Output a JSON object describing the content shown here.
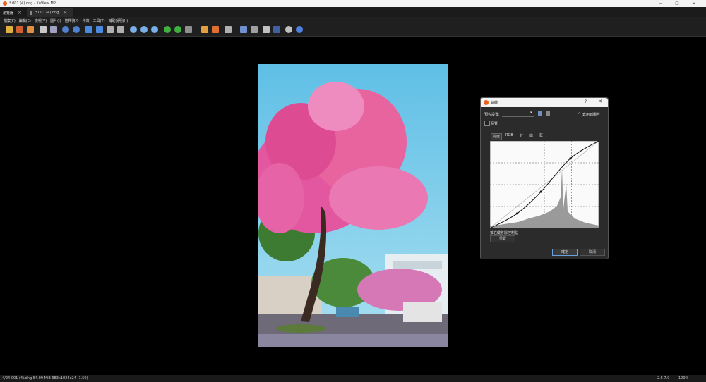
{
  "window": {
    "title": "* 001 (4).dng - XnView MP",
    "minimize": "─",
    "maximize": "☐",
    "close": "✕"
  },
  "tabs": [
    {
      "label": "瀏覽器"
    },
    {
      "label": "* 001 (4).dng"
    }
  ],
  "menu": [
    "檔案(F)",
    "編輯(E)",
    "檢視(V)",
    "圖片(I)",
    "詮釋資料",
    "特效",
    "工具(T)",
    "輔助說明(H)"
  ],
  "status": {
    "left": "4/24   001 (4).dng   54.09 MiB   683x1024x24 (1.50)",
    "right": [
      "2.5 7.9",
      "100%"
    ]
  },
  "dialog": {
    "title": "曲線",
    "help": "?",
    "close": "✕",
    "preset_label": "預先設置:",
    "apply_label": "套用到圖片",
    "apply_checked": "✓",
    "preview_label": "預覽",
    "channels": [
      "亮度",
      "RGB",
      "紅",
      "綠",
      "藍"
    ],
    "hint": "按右鍵移除控制點",
    "reset": "重置",
    "ok": "確定",
    "cancel": "取消",
    "curve_points": [
      [
        0,
        0
      ],
      [
        0.25,
        0.17
      ],
      [
        0.47,
        0.42
      ],
      [
        0.74,
        0.8
      ],
      [
        1,
        1
      ]
    ]
  },
  "colors": {
    "accent": "#e8641b",
    "sky": "#6fc6e6",
    "blossom": "#e2579f"
  }
}
